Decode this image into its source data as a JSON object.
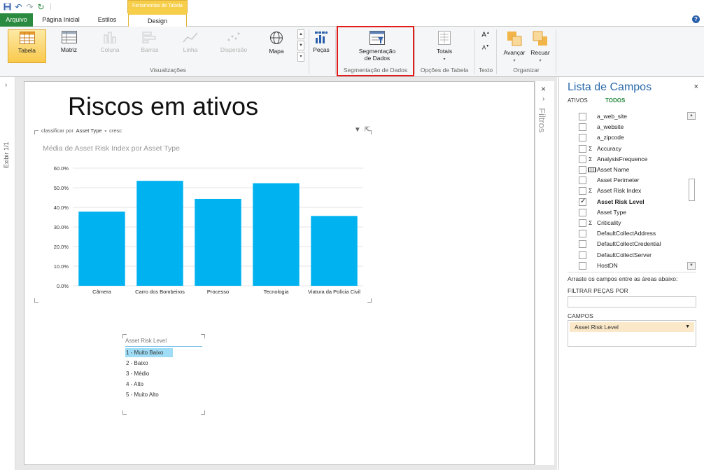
{
  "ribbon_tabs": {
    "file": "Arquivo",
    "home": "Página Inicial",
    "styles": "Estilos",
    "context_header": "Ferramentas de Tabela",
    "design": "Design"
  },
  "ribbon": {
    "visualizations": {
      "label": "Visualizações",
      "buttons": [
        "Tabela",
        "Matriz",
        "Coluna",
        "Barras",
        "Linha",
        "Dispersão",
        "Mapa"
      ]
    },
    "tiles": "Peças",
    "slicer": {
      "label_line1": "Segmentação",
      "label_line2": "de Dados",
      "group": "Segmentação de Dados"
    },
    "table_options": {
      "button": "Totais",
      "group": "Opções de Tabela"
    },
    "text": {
      "group": "Texto"
    },
    "arrange": {
      "forward": "Avançar",
      "backward": "Recuar",
      "group": "Organizar"
    }
  },
  "left_strip": {
    "view_label": "Exibir  1/1"
  },
  "report": {
    "title": "Riscos em ativos",
    "sort": {
      "prefix": "classificar por",
      "field": "Asset Type",
      "order": "cresc"
    }
  },
  "chart_data": {
    "type": "bar",
    "title": "Média de Asset Risk Index por Asset Type",
    "categories": [
      "Câmera",
      "Carro dos Bombeiros",
      "Processo",
      "Tecnologia",
      "Viatura da Polícia Civil"
    ],
    "values": [
      37.8,
      53.5,
      44.3,
      52.3,
      35.6
    ],
    "ylim": [
      0,
      60
    ],
    "yticks": [
      "0.0%",
      "10.0%",
      "20.0%",
      "30.0%",
      "40.0%",
      "50.0%",
      "60.0%"
    ],
    "xlabel": "",
    "ylabel": "",
    "grid": true,
    "color": "#00b2f0"
  },
  "slicer": {
    "title": "Asset Risk Level",
    "items": [
      "1 - Muito Baixo",
      "2 - Baixo",
      "3 - Médio",
      "4 - Alto",
      "5 - Muito Alto"
    ]
  },
  "filters": {
    "label": "Filtros"
  },
  "field_list": {
    "title": "Lista de Campos",
    "tab_active": "ATIVOS",
    "tab_all": "TODOS",
    "fields": [
      {
        "name": "a_web_site",
        "sigma": false,
        "checked": false
      },
      {
        "name": "a_website",
        "sigma": false,
        "checked": false
      },
      {
        "name": "a_zipcode",
        "sigma": false,
        "checked": false
      },
      {
        "name": "Accuracy",
        "sigma": true,
        "checked": false
      },
      {
        "name": "AnalysisFrequence",
        "sigma": true,
        "checked": false
      },
      {
        "name": "Asset Name",
        "sigma": false,
        "checked": false,
        "icon": "table-field-icon"
      },
      {
        "name": "Asset Perimeter",
        "sigma": false,
        "checked": false
      },
      {
        "name": "Asset Risk Index",
        "sigma": true,
        "checked": false
      },
      {
        "name": "Asset Risk Level",
        "sigma": false,
        "checked": true
      },
      {
        "name": "Asset Type",
        "sigma": false,
        "checked": false
      },
      {
        "name": "Criticality",
        "sigma": true,
        "checked": false
      },
      {
        "name": "DefaultCollectAddress",
        "sigma": false,
        "checked": false
      },
      {
        "name": "DefaultCollectCredential",
        "sigma": false,
        "checked": false
      },
      {
        "name": "DefaultCollectServer",
        "sigma": false,
        "checked": false
      },
      {
        "name": "HostDN",
        "sigma": false,
        "checked": false
      }
    ],
    "hint": "Arraste os campos entre as áreas abaixo:",
    "filter_tiles_label": "FILTRAR PEÇAS POR",
    "fields_label": "CAMPOS",
    "fields_chip": "Asset Risk Level"
  }
}
